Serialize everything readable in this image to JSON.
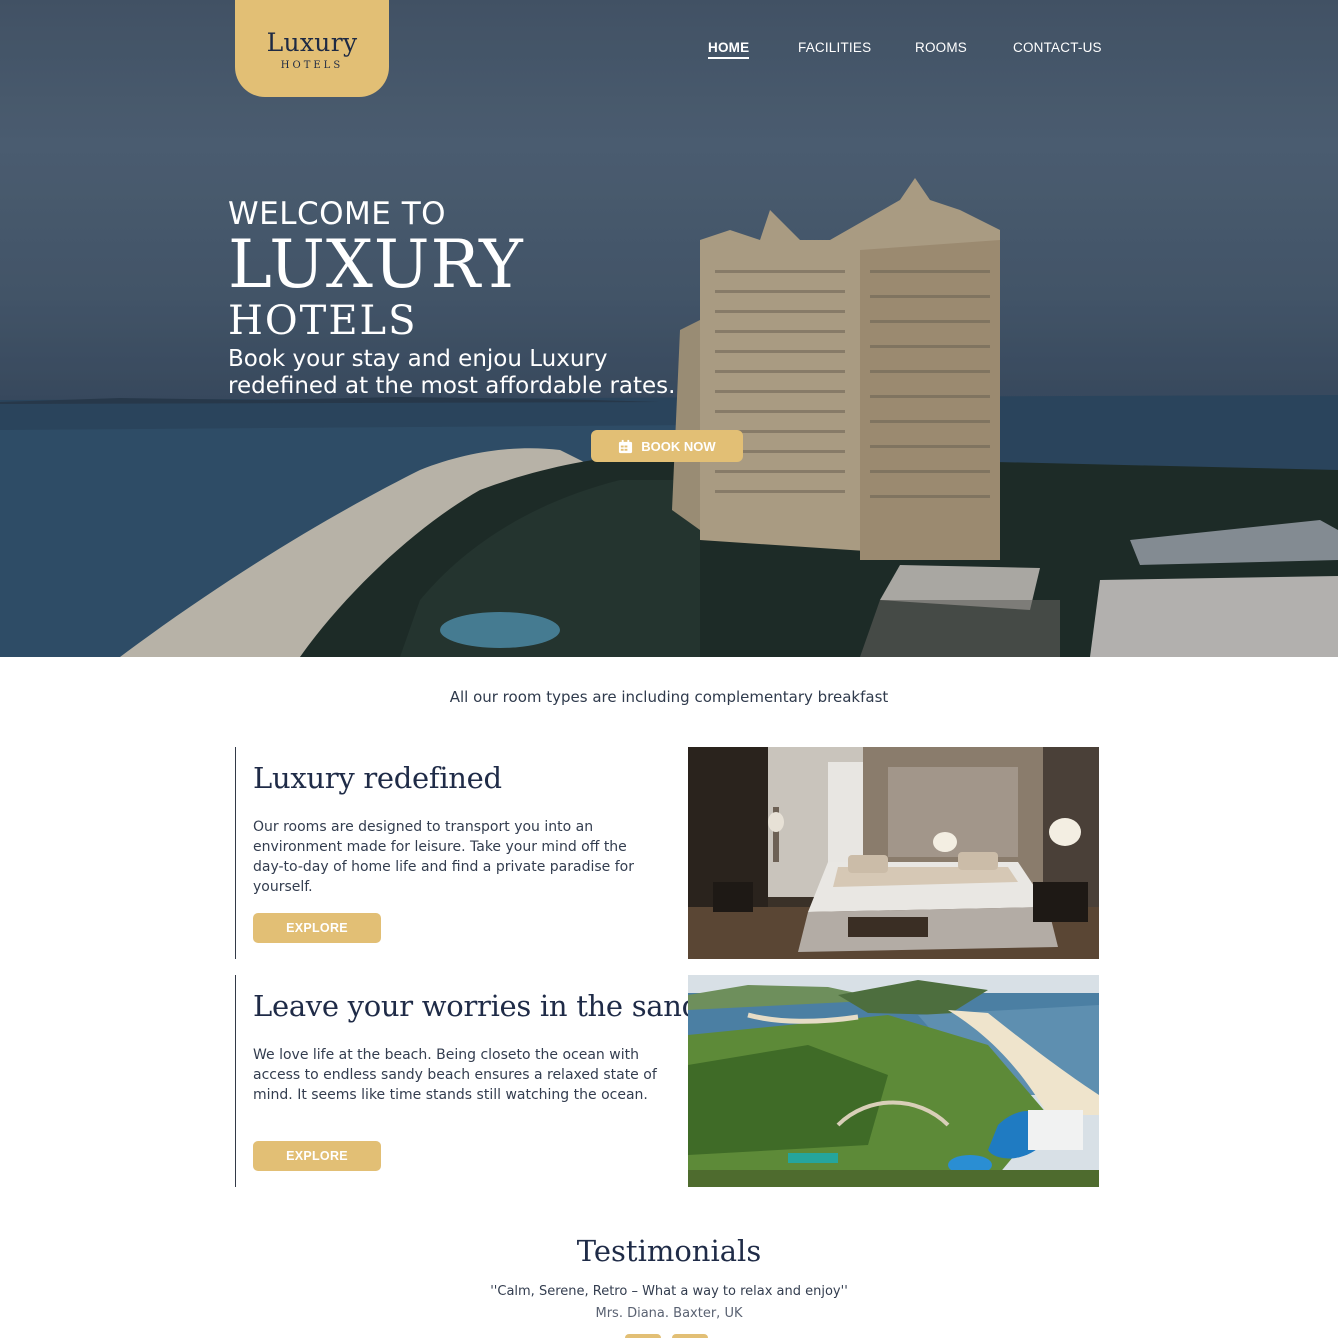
{
  "brand": {
    "name": "Luxury",
    "sub": "HOTELS"
  },
  "nav": {
    "items": [
      {
        "label": "HOME",
        "active": true
      },
      {
        "label": "FACILITIES",
        "active": false
      },
      {
        "label": "ROOMS",
        "active": false
      },
      {
        "label": "CONTACT-US",
        "active": false
      }
    ]
  },
  "hero": {
    "welcome": "WELCOME TO",
    "title": "LUXURY",
    "subtitle": "HOTELS",
    "tagline": "Book your stay and enjou Luxury redefined at the most affordable rates.",
    "cta_label": "BOOK NOW",
    "cta_icon": "calendar-icon"
  },
  "intro": "All our room types are including complementary breakfast",
  "features": [
    {
      "title": "Luxury redefined",
      "body": "Our rooms are designed to transport you into an environment made for leisure. Take your mind off the day-to-day of home life and find a private paradise for yourself.",
      "button": "EXPLORE"
    },
    {
      "title": "Leave your worries in the sand",
      "body": "We love life at the beach. Being closeto the ocean with access to endless sandy beach ensures a relaxed state of mind. It seems like time stands still watching the ocean.",
      "button": "EXPLORE"
    }
  ],
  "testimonials": {
    "title": "Testimonials",
    "quote": "''Calm, Serene, Retro – What a way to relax and enjoy''",
    "author": "Mrs. Diana. Baxter, UK"
  },
  "colors": {
    "accent": "#e2bf75",
    "navy": "#1f2b47"
  }
}
